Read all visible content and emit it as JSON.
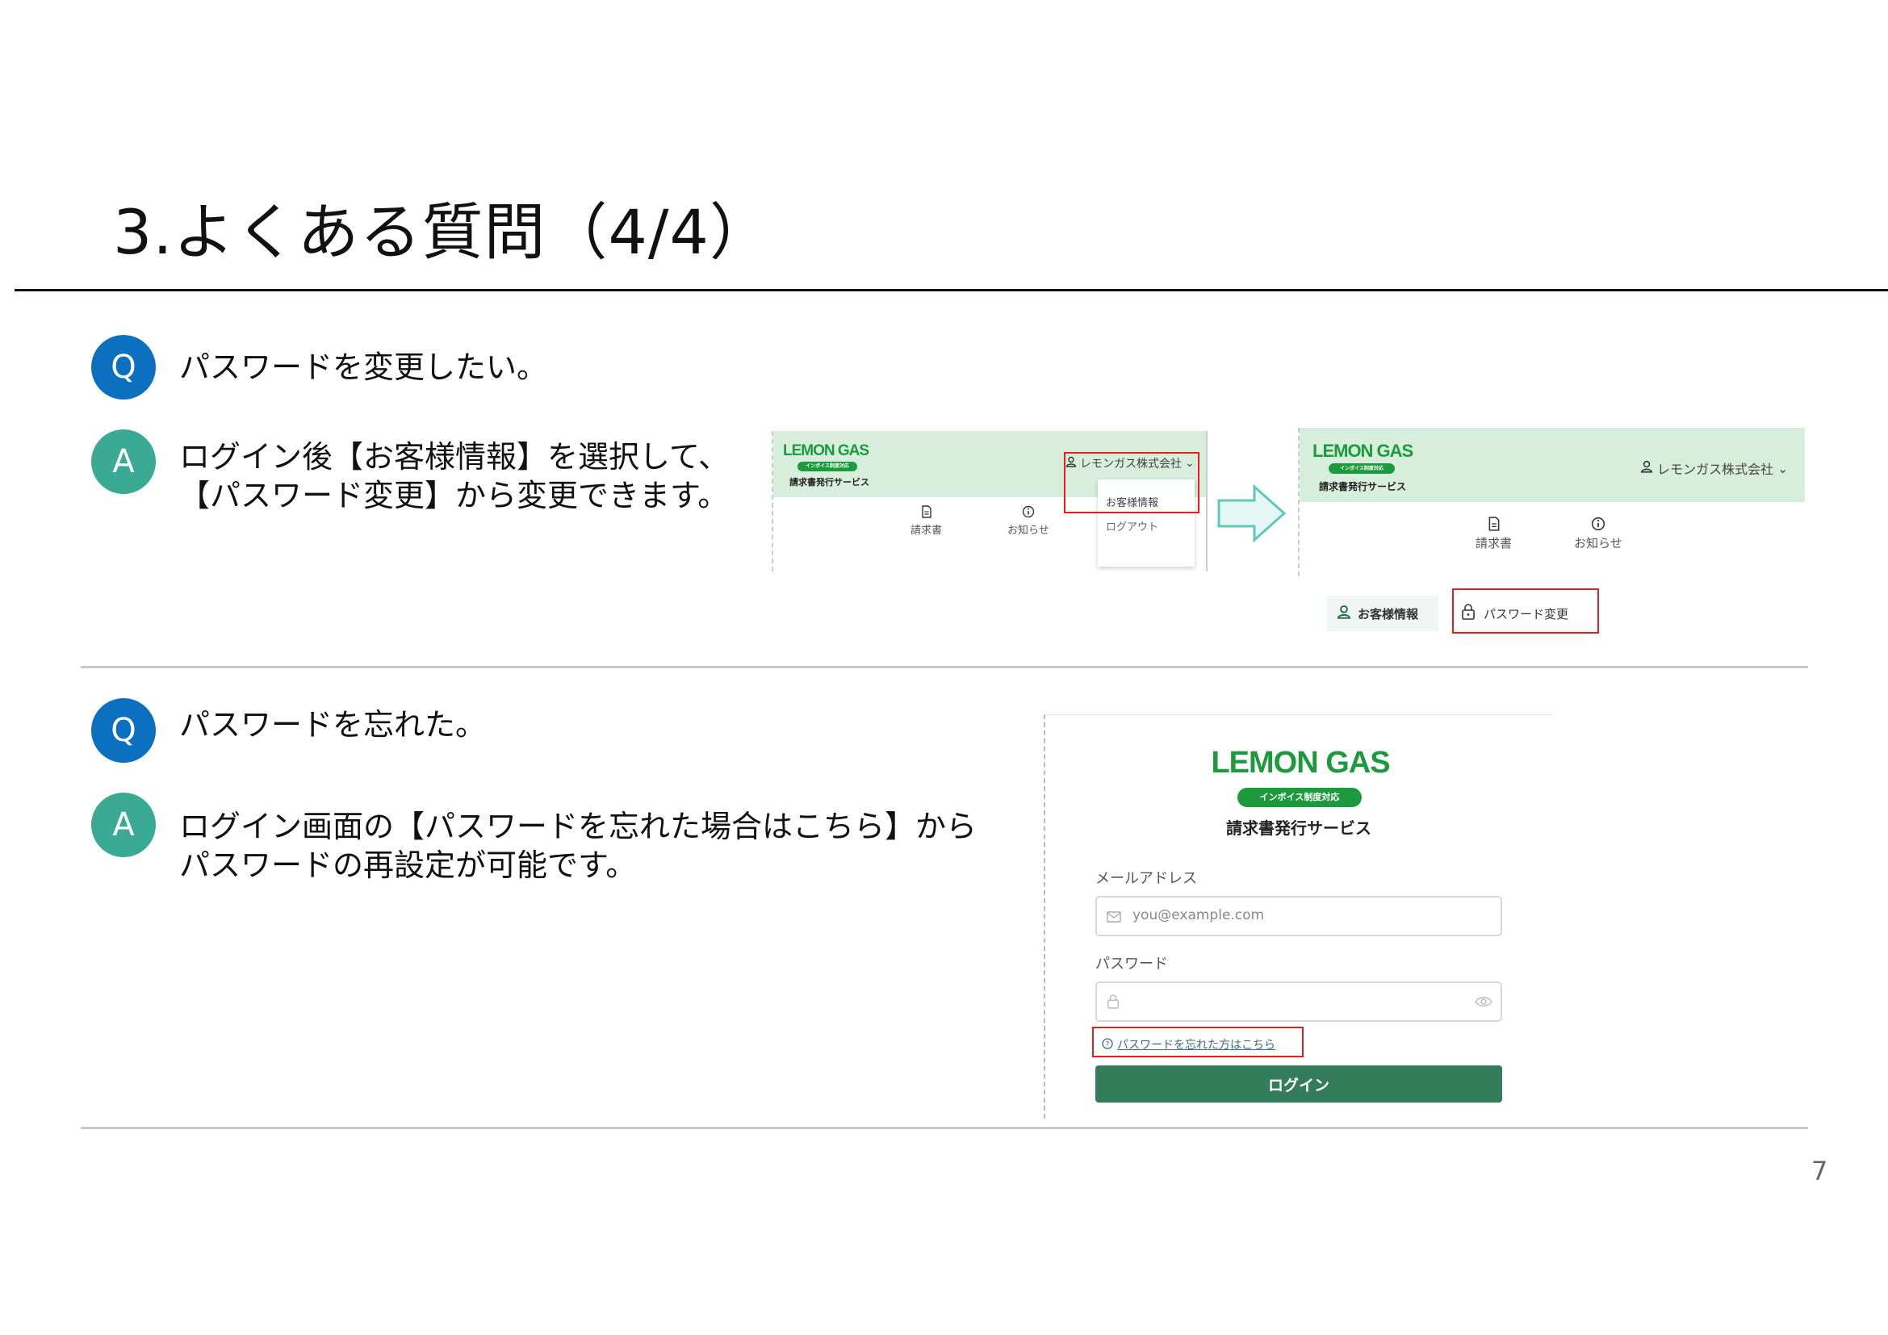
{
  "page": {
    "title": "3.よくある質問（4/4）",
    "page_number": "7"
  },
  "faq": [
    {
      "q_badge": "Q",
      "question": "パスワードを変更したい。",
      "a_badge": "A",
      "answer_lines": [
        "ログイン後【お客様情報】を選択して、",
        "【パスワード変更】から変更できます。"
      ]
    },
    {
      "q_badge": "Q",
      "question": "パスワードを忘れた。",
      "a_badge": "A",
      "answer_lines": [
        "ログイン画面の【パスワードを忘れた場合はこちら】から",
        "パスワードの再設定が可能です。"
      ]
    }
  ],
  "screens": {
    "logo": "LEMON GAS",
    "logo_badge": "インボイス制度対応",
    "service": "請求書発行サービス",
    "company_menu": "レモンガス株式会社",
    "dropdown": [
      "お客様情報",
      "ログアウト"
    ],
    "nav": [
      "請求書",
      "お知らせ"
    ],
    "sub_tabs": [
      "お客様情報",
      "パスワード変更"
    ]
  },
  "login": {
    "logo": "LEMON GAS",
    "logo_badge": "インボイス制度対応",
    "service": "請求書発行サービス",
    "email_label": "メールアドレス",
    "email_placeholder": "you@example.com",
    "password_label": "パスワード",
    "forgot_link": "パスワードを忘れた方はこちら",
    "login_button": "ログイン"
  },
  "colors": {
    "q_badge": "#0b70c0",
    "a_badge": "#3aaa94",
    "brand_green": "#1c9a3d",
    "header_mint": "#d7eedc",
    "login_button": "#337d5a",
    "highlight_red": "#e0201e"
  }
}
